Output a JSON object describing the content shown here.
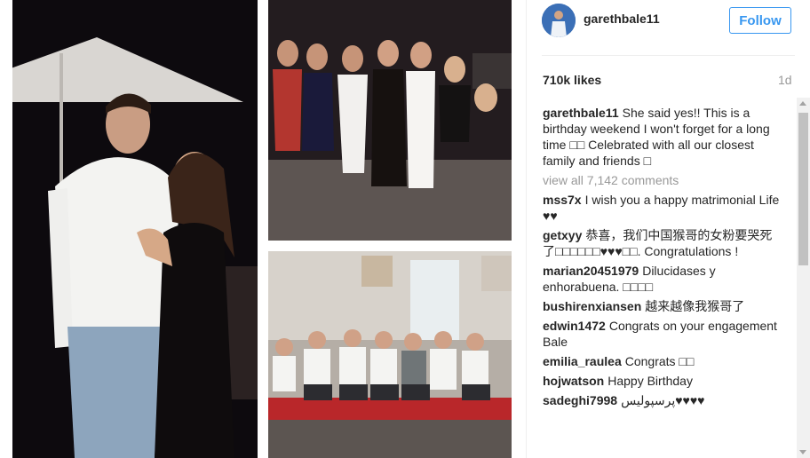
{
  "post": {
    "username": "garethbale11",
    "follow_label": "Follow",
    "likes": "710k likes",
    "time_ago": "1d",
    "view_all_label": "view all 7,142 comments"
  },
  "comments": [
    {
      "user": "garethbale11",
      "text": "She said yes!! This is a birthday weekend I won't forget for a long time □□ Celebrated with all our closest family and friends □"
    },
    {
      "user": "mss7x",
      "text": "I wish you a happy matrimonial Life ♥♥"
    },
    {
      "user": "getxyy",
      "text": "恭喜，我们中国猴哥的女粉要哭死了□□□□□□♥♥♥□□. Congratulations !"
    },
    {
      "user": "marian20451979",
      "text": "Dilucidases y enhorabuena. □□□□"
    },
    {
      "user": "bushirenxiansen",
      "text": "越来越像我猴哥了"
    },
    {
      "user": "edwin1472",
      "text": "Congrats on your engagement Bale"
    },
    {
      "user": "emilia_raulea",
      "text": "Congrats □□"
    },
    {
      "user": "hojwatson",
      "text": "Happy Birthday"
    },
    {
      "user": "sadeghi7998",
      "text": "پرسپولیس♥♥♥♥"
    }
  ],
  "icons": {
    "avatar": "profile-photo",
    "scroll_up": "arrow-up",
    "scroll_down": "arrow-down"
  },
  "colors": {
    "accent": "#3897f0",
    "text": "#262626",
    "muted": "#999999"
  }
}
